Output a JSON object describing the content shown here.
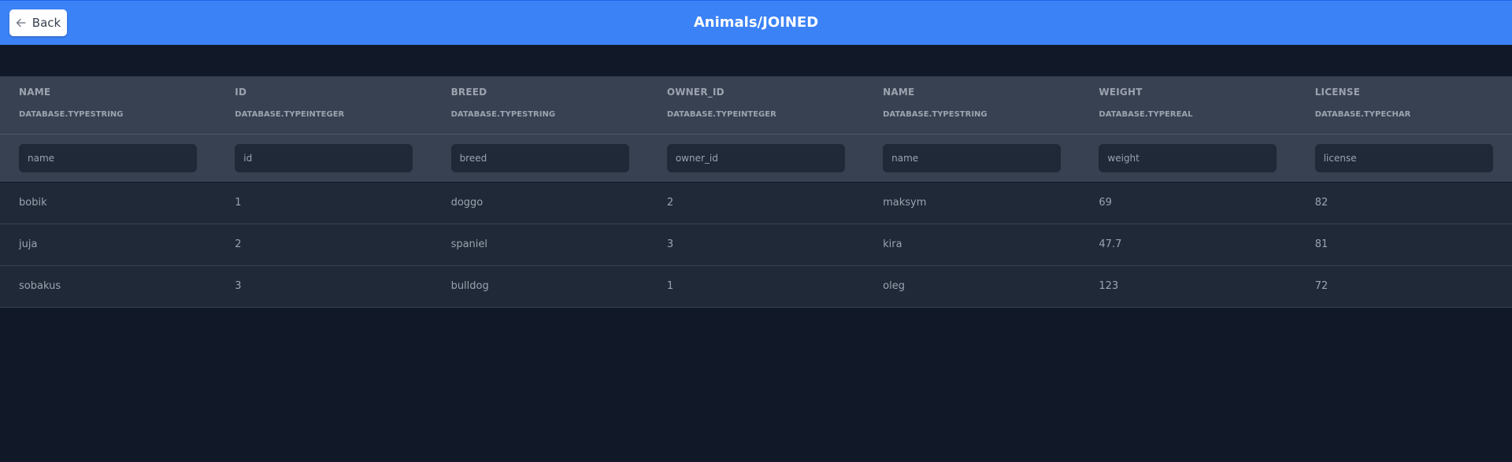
{
  "header": {
    "back_label": "Back",
    "title": "Animals/JOINED",
    "background": "#3b82f6"
  },
  "table": {
    "columns": [
      {
        "name": "NAME",
        "type": "DATABASE.TYPESTRING",
        "placeholder": "name"
      },
      {
        "name": "ID",
        "type": "DATABASE.TYPEINTEGER",
        "placeholder": "id"
      },
      {
        "name": "BREED",
        "type": "DATABASE.TYPESTRING",
        "placeholder": "breed"
      },
      {
        "name": "OWNER_ID",
        "type": "DATABASE.TYPEINTEGER",
        "placeholder": "owner_id"
      },
      {
        "name": "NAME",
        "type": "DATABASE.TYPESTRING",
        "placeholder": "name"
      },
      {
        "name": "WEIGHT",
        "type": "DATABASE.TYPEREAL",
        "placeholder": "weight"
      },
      {
        "name": "LICENSE",
        "type": "DATABASE.TYPECHAR",
        "placeholder": "license"
      }
    ],
    "rows": [
      [
        "bobik",
        "1",
        "doggo",
        "2",
        "maksym",
        "69",
        "82"
      ],
      [
        "juja",
        "2",
        "spaniel",
        "3",
        "kira",
        "47.7",
        "81"
      ],
      [
        "sobakus",
        "3",
        "bulldog",
        "1",
        "oleg",
        "123",
        "72"
      ]
    ]
  }
}
